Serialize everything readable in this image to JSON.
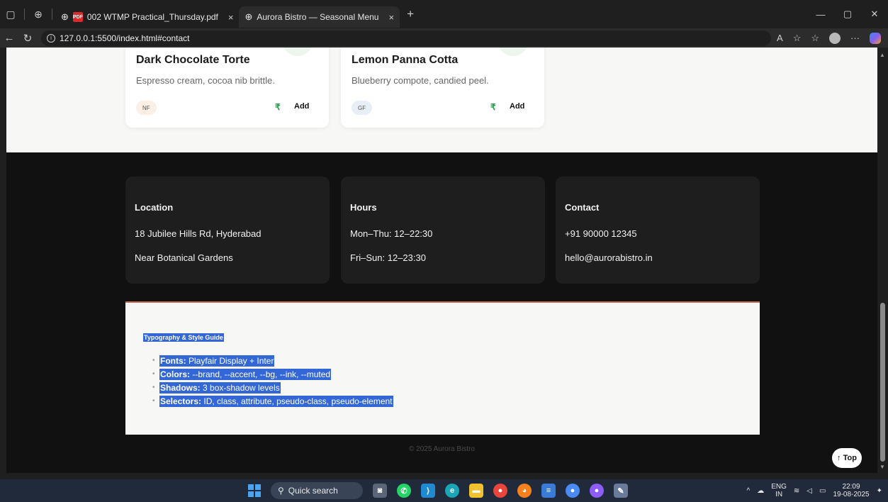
{
  "browser": {
    "tabs": [
      {
        "title": "002 WTMP Practical_Thursday.pdf",
        "icon": "pdf-icon",
        "active": false
      },
      {
        "title": "Aurora Bistro — Seasonal Menu",
        "icon": "globe-icon",
        "active": true
      }
    ],
    "url": "127.0.0.1:5500/index.html#contact"
  },
  "menu_items": [
    {
      "name": "Dark Chocolate Torte",
      "desc": "Espresso cream, cocoa nib brittle.",
      "tag": "NF",
      "currency": "₹",
      "add_label": "Add"
    },
    {
      "name": "Lemon Panna Cotta",
      "desc": "Blueberry compote, candied peel.",
      "tag": "GF",
      "currency": "₹",
      "add_label": "Add"
    }
  ],
  "info": {
    "location": {
      "title": "Location",
      "line1": "18 Jubilee Hills Rd, Hyderabad",
      "line2": "Near Botanical Gardens"
    },
    "hours": {
      "title": "Hours",
      "line1": "Mon–Thu: 12–22:30",
      "line2": "Fri–Sun: 12–23:30"
    },
    "contact": {
      "title": "Contact",
      "line1": "+91 90000 12345",
      "line2": "hello@aurorabistro.in"
    }
  },
  "guide": {
    "title": "Typography & Style Guide",
    "items": [
      {
        "label": "Fonts:",
        "text": " Playfair Display + Inter"
      },
      {
        "label": "Colors:",
        "text": " --brand, --accent, --bg, --ink, --muted"
      },
      {
        "label": "Shadows:",
        "text": " 3 box-shadow levels"
      },
      {
        "label": "Selectors:",
        "text": " ID, class, attribute, pseudo-class, pseudo-element"
      }
    ]
  },
  "footer": {
    "copyright": "© 2025 Aurora Bistro",
    "top_label": "↑ Top"
  },
  "taskbar": {
    "search_placeholder": "Quick search",
    "lang": "ENG",
    "region": "IN",
    "time": "22:09",
    "date": "19-08-2025"
  }
}
